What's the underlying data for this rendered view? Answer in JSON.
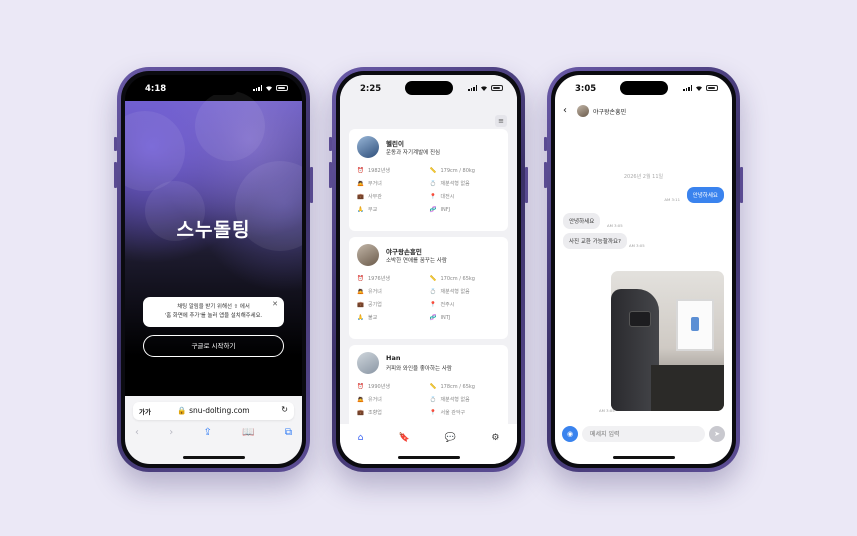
{
  "phone1": {
    "time": "4:18",
    "brand": "스누돌팅",
    "toast_line1": "채팅 알림을 받기 위해선 ⇧ 에서",
    "toast_line2": "'홈 화면에 추가'를 눌러 앱을 설치해주세요.",
    "google_button": "구글로 시작하기",
    "url_aa": "가가",
    "url": "🔒 snu-dolting.com",
    "icons": [
      "back-icon",
      "forward-icon",
      "share-icon",
      "bookmarks-icon",
      "tabs-icon"
    ]
  },
  "phone2": {
    "time": "2:25",
    "cards": [
      {
        "name": "헬린이",
        "intro": "운동과 자기계발에 진심",
        "attrs": [
          "1982년생",
          "179cm / 80kg",
          "무거녀",
          "재분석형 없음",
          "사무관",
          "대전시",
          "무교",
          "INFJ"
        ]
      },
      {
        "name": "야구왕손흥민",
        "intro": "소박한 연애를 꿈꾸는 사람",
        "attrs": [
          "1976년생",
          "170cm / 65kg",
          "유거녀",
          "재분석형 없음",
          "공기업",
          "전주시",
          "불교",
          "INTJ"
        ]
      },
      {
        "name": "Han",
        "intro": "커피와 와인을 좋아하는 사람",
        "attrs": [
          "1990년생",
          "178cm / 65kg",
          "유거녀",
          "재분석형 없음",
          "조향업",
          "서울 관악구",
          "",
          ""
        ]
      }
    ],
    "tabs": [
      "home-icon",
      "bookmark-icon",
      "chat-icon",
      "settings-icon"
    ]
  },
  "phone3": {
    "time": "3:05",
    "chat_name": "야구왕손흥민",
    "date": "2026년 2월 11일",
    "messages": [
      {
        "from": "me",
        "text": "안녕하세요",
        "time": "AM 3:11"
      },
      {
        "from": "them",
        "text": "안녕하세요",
        "time": "AM 3:05"
      },
      {
        "from": "them",
        "text": "사진 교환 가능할까요?",
        "time": "AM 3:05"
      }
    ],
    "photo_time": "AM 3:05",
    "input_placeholder": "메세지 입력"
  }
}
